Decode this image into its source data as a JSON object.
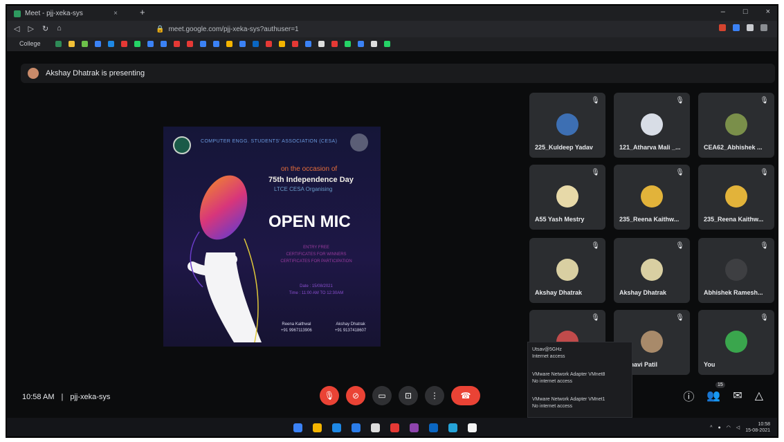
{
  "browser": {
    "tab_title": "Meet - pjj-xeka-sys",
    "tab_close": "×",
    "new_tab": "+",
    "window_buttons": [
      "–",
      "□",
      "×"
    ],
    "url": "meet.google.com/pjj-xeka-sys?authuser=1",
    "bookmark_folder": "College",
    "nav_buttons": [
      "◁",
      "▷",
      "↻",
      "⌂"
    ]
  },
  "meet": {
    "presenting_text": "Akshay Dhatrak is presenting",
    "time": "10:58 AM",
    "separator": "|",
    "meeting_code": "pjj-xeka-sys",
    "people_count": "15"
  },
  "poster": {
    "org": "COMPUTER ENGG. STUDENTS' ASSOCIATION (CESA)",
    "occasion": "on the occasion of",
    "independence": "75th Independence Day",
    "org2": "LTCE CESA Organising",
    "title": "OPEN MIC",
    "line1": "ENTRY FREE",
    "line2": "CERTIFICATES FOR WINNERS",
    "line3": "CERTIFICATES FOR PARTICIPATION",
    "date": "Date : 15/08/2021",
    "time": "Time : 11:00 AM TO 12:30AM",
    "contact1_name": "Reena Kaithwal",
    "contact1_phone": "+91 9967113906",
    "contact2_name": "Akshay Dhatrak",
    "contact2_phone": "+91 9137418607"
  },
  "participants": [
    {
      "name": "225_Kuldeep Yadav"
    },
    {
      "name": "121_Atharva Mali _..."
    },
    {
      "name": "CEA62_Abhishek ..."
    },
    {
      "name": "A55 Yash Mestry"
    },
    {
      "name": "235_Reena Kaithw..."
    },
    {
      "name": "235_Reena Kaithw..."
    },
    {
      "name": "Akshay Dhatrak"
    },
    {
      "name": "Akshay Dhatrak"
    },
    {
      "name": "Abhishek Ramesh..."
    },
    {
      "name": ""
    },
    {
      "name": "Janhavi Patil"
    },
    {
      "name": "You"
    }
  ],
  "network_popup": {
    "item1_name": "Utsav@5GHz",
    "item1_status": "Internet access",
    "item2_name": "VMware Network Adapter VMnet8",
    "item2_status": "No internet access",
    "item3_name": "VMware Network Adapter VMnet1",
    "item3_status": "No internet access"
  },
  "taskbar": {
    "clock_time": "10:58",
    "clock_date": "15-08-2021",
    "tray_up": "^"
  },
  "colors": {
    "red": "#ea4335",
    "bg": "#0b0c0d",
    "tile": "#2b2d30"
  }
}
